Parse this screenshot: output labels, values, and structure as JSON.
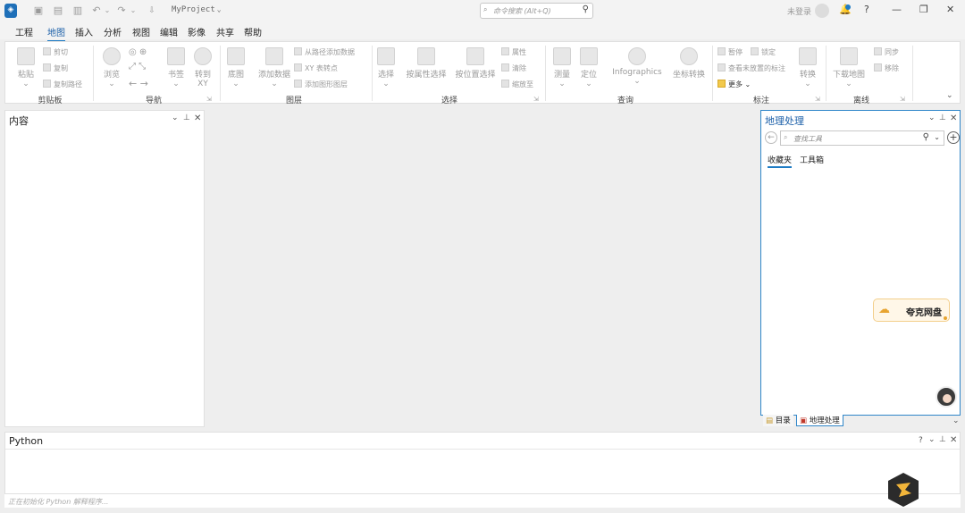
{
  "titlebar": {
    "project": "MyProject",
    "search_placeholder": "命令搜索 (Alt+Q)",
    "login": "未登录",
    "help": "?",
    "minimize": "—",
    "restore": "❐",
    "close": "✕"
  },
  "menu": {
    "items": [
      "工程",
      "地图",
      "插入",
      "分析",
      "视图",
      "编辑",
      "影像",
      "共享",
      "帮助"
    ],
    "active": "地图"
  },
  "ribbon": {
    "clipboard": {
      "paste": "粘贴",
      "cut": "剪切",
      "copy": "复制",
      "copy_path": "复制路径",
      "label": "剪贴板"
    },
    "navigate": {
      "explore": "浏览",
      "bookmarks": "书签",
      "goto_xy": "转到\nXY",
      "label": "导航"
    },
    "layer": {
      "basemap": "底图",
      "add_data": "添加数据",
      "add_from_path": "从路径添加数据",
      "xy_to_point": "XY 表转点",
      "add_graphics": "添加图形图层",
      "label": "图层"
    },
    "selection": {
      "select": "选择",
      "by_attr": "按属性选择",
      "by_loc": "按位置选择",
      "attributes": "属性",
      "clear": "清除",
      "zoom_to": "缩放至",
      "label": "选择"
    },
    "inquiry": {
      "measure": "测量",
      "locate": "定位",
      "infographics": "Infographics",
      "coord": "坐标转换",
      "label": "查询"
    },
    "labeling": {
      "pause": "暂停",
      "lock": "锁定",
      "view_unplaced": "查看未放置的标注",
      "more": "更多",
      "convert": "转换",
      "label": "标注"
    },
    "offline": {
      "download_map": "下载地图",
      "sync": "同步",
      "remove": "移除",
      "label": "离线"
    }
  },
  "contents": {
    "title": "内容"
  },
  "geoprocessing": {
    "title": "地理处理",
    "search_placeholder": "查找工具",
    "tabs": [
      "收藏夹",
      "工具箱"
    ],
    "bottom_tabs": [
      "目录",
      "地理处理"
    ]
  },
  "overlay": {
    "quark": "夸克网盘"
  },
  "python": {
    "title": "Python",
    "status": "正在初始化 Python 解释程序..."
  }
}
